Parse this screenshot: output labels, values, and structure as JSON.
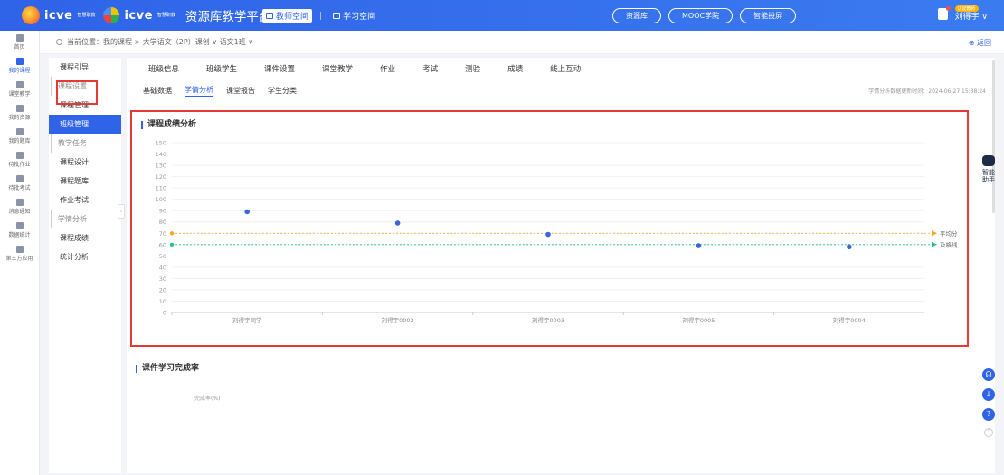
{
  "header": {
    "logo_text_1": "icve",
    "logo_sub_1": "智慧职教",
    "logo_text_2": "icve",
    "logo_sub_2": "智慧职教",
    "platform_name": "资源库教学平台",
    "space_tabs": [
      "教师空间",
      "学习空间"
    ],
    "pills": [
      "资源库",
      "MOOC学院",
      "智能投屏"
    ],
    "user_badge": "认证教师",
    "user_name": "刘得宇 ∨"
  },
  "rail": [
    "首页",
    "我的课程",
    "课堂教学",
    "我的资源",
    "我的题库",
    "待批作业",
    "待批考试",
    "消息通知",
    "数据统计",
    "第三方应用"
  ],
  "breadcrumb": "当前位置：我的课程 > 大学语文（2P）课创 ∨ 语文1班 ∨",
  "back": "返回",
  "submenu": [
    {
      "type": "item",
      "label": "课程引导"
    },
    {
      "type": "group",
      "label": "课程设置"
    },
    {
      "type": "item",
      "label": "课程管理"
    },
    {
      "type": "item",
      "label": "班级管理",
      "active": true
    },
    {
      "type": "group",
      "label": "教学任务"
    },
    {
      "type": "item",
      "label": "课程设计"
    },
    {
      "type": "item",
      "label": "课程题库"
    },
    {
      "type": "item",
      "label": "作业考试"
    },
    {
      "type": "group",
      "label": "学情分析"
    },
    {
      "type": "item",
      "label": "课程成绩"
    },
    {
      "type": "item",
      "label": "统计分析"
    }
  ],
  "nav_tabs": [
    "班级信息",
    "班级学生",
    "课件设置",
    "课堂教学",
    "作业",
    "考试",
    "测验",
    "成绩",
    "线上互动"
  ],
  "sub_tabs": [
    "基础数据",
    "学情分析",
    "课堂报告",
    "学生分类"
  ],
  "update_time": "学情分析数据更新时间：2024-06-27 15:38:24",
  "card1_title": "课程成绩分析",
  "card2_title": "课件学习完成率",
  "rate_label": "完成率(%)",
  "robot_text": "智能助手",
  "chart_data": {
    "type": "scatter",
    "categories": [
      "刘得宇同学",
      "刘得宇0002",
      "刘得宇0003",
      "刘得宇0005",
      "刘得宇0004"
    ],
    "values": [
      89,
      79,
      69,
      59,
      58
    ],
    "reference_lines": [
      {
        "name": "平均分",
        "value": 70,
        "color": "#f5a623"
      },
      {
        "name": "及格线",
        "value": 60,
        "color": "#2ec27e"
      }
    ],
    "yticks": [
      0,
      10,
      20,
      30,
      40,
      50,
      60,
      70,
      80,
      90,
      100,
      110,
      120,
      130,
      140,
      150
    ],
    "ylim": [
      0,
      150
    ],
    "grid": true,
    "point_color": "#3a66d9"
  }
}
